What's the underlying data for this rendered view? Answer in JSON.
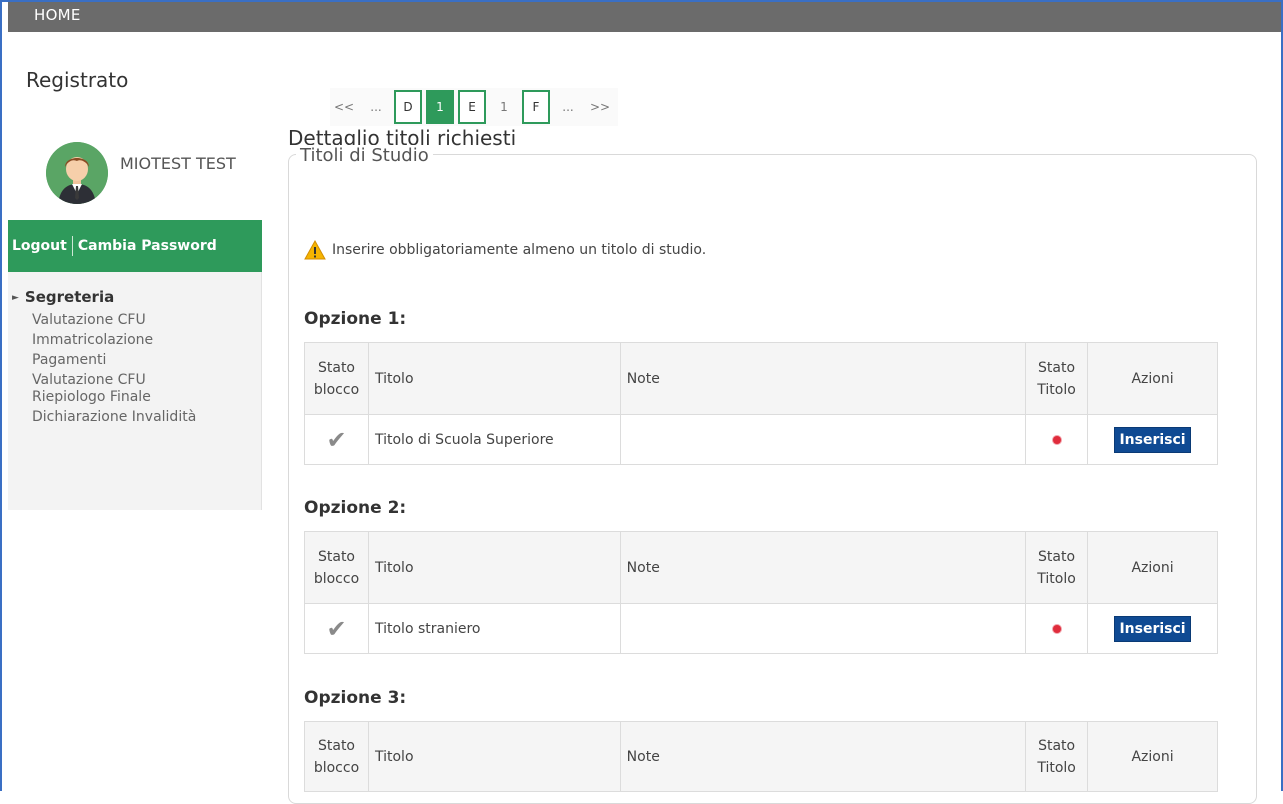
{
  "topbar": {
    "home_label": "HOME"
  },
  "sidebar": {
    "registered_label": "Registrato",
    "user_name": "MIOTEST TEST",
    "logout_label": "Logout",
    "change_password_label": "Cambia Password",
    "menu_head": "Segreteria",
    "menu_items": [
      "Valutazione CFU",
      "Immatricolazione",
      "Pagamenti",
      "Valutazione CFU",
      "Riepiologo Finale",
      "Dichiarazione Invalidità"
    ]
  },
  "pager": [
    "<<",
    "...",
    "D",
    "1",
    "E",
    "1",
    "F",
    "...",
    ">>"
  ],
  "main": {
    "title": "Dettaglio titoli richiesti",
    "fieldset_legend": "Titoli di Studio",
    "warning": "Inserire obbligatoriamente almeno un titolo di studio."
  },
  "table_headers": {
    "stato_blocco": [
      "Stato",
      "blocco"
    ],
    "titolo": "Titolo",
    "note": "Note",
    "stato_titolo": [
      "Stato",
      "Titolo"
    ],
    "azioni": "Azioni"
  },
  "options": [
    {
      "label": "Opzione 1:",
      "row": {
        "titolo": "Titolo di Scuola Superiore",
        "note": "",
        "action": "Inserisci"
      }
    },
    {
      "label": "Opzione 2:",
      "row": {
        "titolo": "Titolo straniero",
        "note": "",
        "action": "Inserisci"
      }
    },
    {
      "label": "Opzione 3:"
    }
  ],
  "colors": {
    "green": "#2e9a5b",
    "button_blue": "#0f4a93",
    "status_red": "#e02c3c",
    "topbar": "#6b6b6b"
  },
  "icons": {
    "warning": "warning-icon",
    "check": "check-icon",
    "status": "status-dot-icon",
    "menu": "triangle-right-icon"
  }
}
